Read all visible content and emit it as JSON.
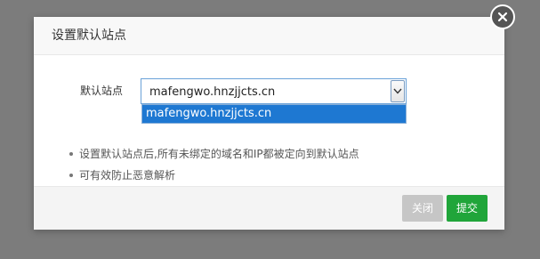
{
  "dialog": {
    "title": "设置默认站点",
    "close_icon": "close-icon",
    "form": {
      "label": "默认站点",
      "selected_value": "mafengwo.hnzjjcts.cn",
      "options": [
        "mafengwo.hnzjjcts.cn"
      ]
    },
    "tips": [
      "设置默认站点后,所有未绑定的域名和IP都被定向到默认站点",
      "可有效防止恶意解析"
    ],
    "buttons": {
      "close_label": "关闭",
      "submit_label": "提交"
    }
  },
  "colors": {
    "overlay": "#7c7c7c",
    "selected_option": "#1e78d2",
    "submit_button": "#20a53a",
    "close_button": "#c6c6c6"
  }
}
